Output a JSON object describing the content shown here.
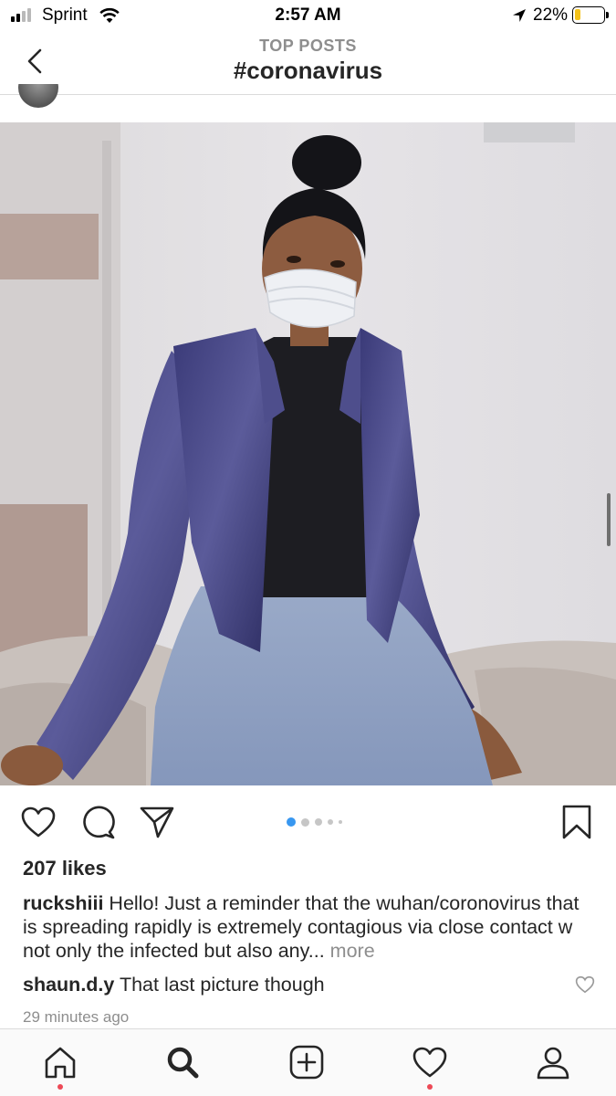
{
  "status_bar": {
    "carrier": "Sprint",
    "time": "2:57 AM",
    "battery_percent": "22%",
    "battery_level": 0.22
  },
  "header": {
    "subtitle": "TOP POSTS",
    "title": "#coronavirus"
  },
  "post": {
    "carousel_count": 5,
    "carousel_active_index": 0,
    "likes": "207 likes",
    "caption": {
      "username": "ruckshiii",
      "text": " Hello! Just a reminder that the wuhan/coronovirus that is spreading rapidly is extremely contagious via close contact w not only the infected but also any...",
      "more_label": " more"
    },
    "comment": {
      "username": "shaun.d.y",
      "text": " That last picture though"
    },
    "timestamp": "29 minutes ago"
  },
  "icons": {
    "back": "chevron-left-icon",
    "like": "heart-outline-icon",
    "comment": "speech-bubble-icon",
    "share": "paper-plane-icon",
    "save": "bookmark-icon",
    "home": "home-icon",
    "search": "search-icon",
    "new_post": "plus-square-icon",
    "activity": "heart-icon",
    "profile": "person-icon"
  },
  "colors": {
    "carousel_active": "#3897f0",
    "notification_dot": "#ed4956",
    "battery": "#f4c21a"
  }
}
